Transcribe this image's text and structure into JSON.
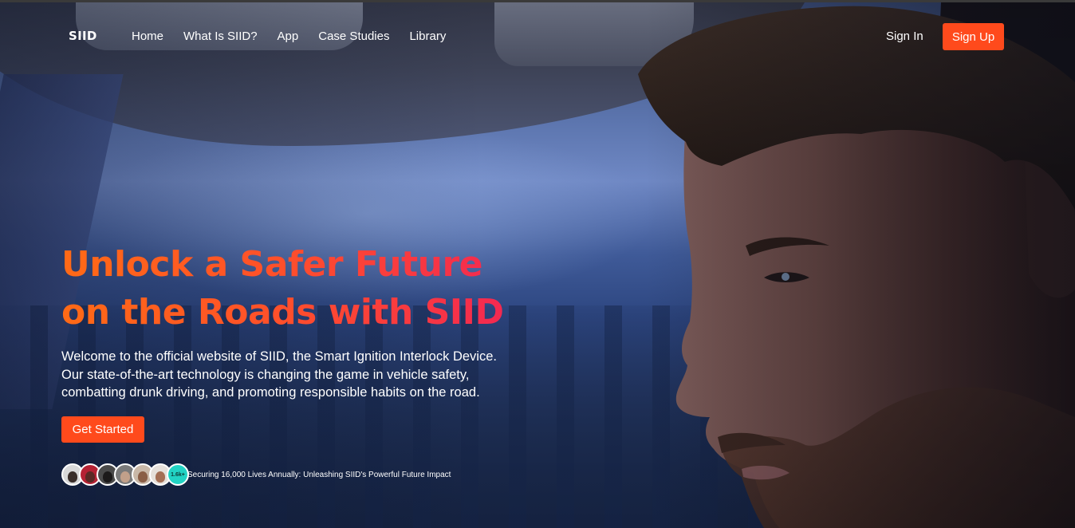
{
  "brand": {
    "logo": "SIID"
  },
  "nav": {
    "links": [
      "Home",
      "What Is SIID?",
      "App",
      "Case Studies",
      "Library"
    ],
    "sign_in": "Sign In",
    "sign_up": "Sign Up"
  },
  "hero": {
    "headline_line1": "Unlock a Safer Future",
    "headline_line2": "on the Roads with SIID",
    "intro": "Welcome to the official website of SIID, the Smart Ignition Interlock Device. Our state-of-the-art technology is changing the game in vehicle safety, combatting drunk driving, and promoting responsible habits on the road.",
    "cta": "Get Started",
    "supporters_count": "1.6k+",
    "impact_text": "Securing 16,000 Lives Annually: Unleashing SIID's Powerful Future Impact"
  },
  "colors": {
    "accent": "#ff4a1c",
    "headline_gradient_start": "#ff6a16",
    "headline_gradient_end": "#f0205a",
    "count_badge": "#22d3c4"
  }
}
